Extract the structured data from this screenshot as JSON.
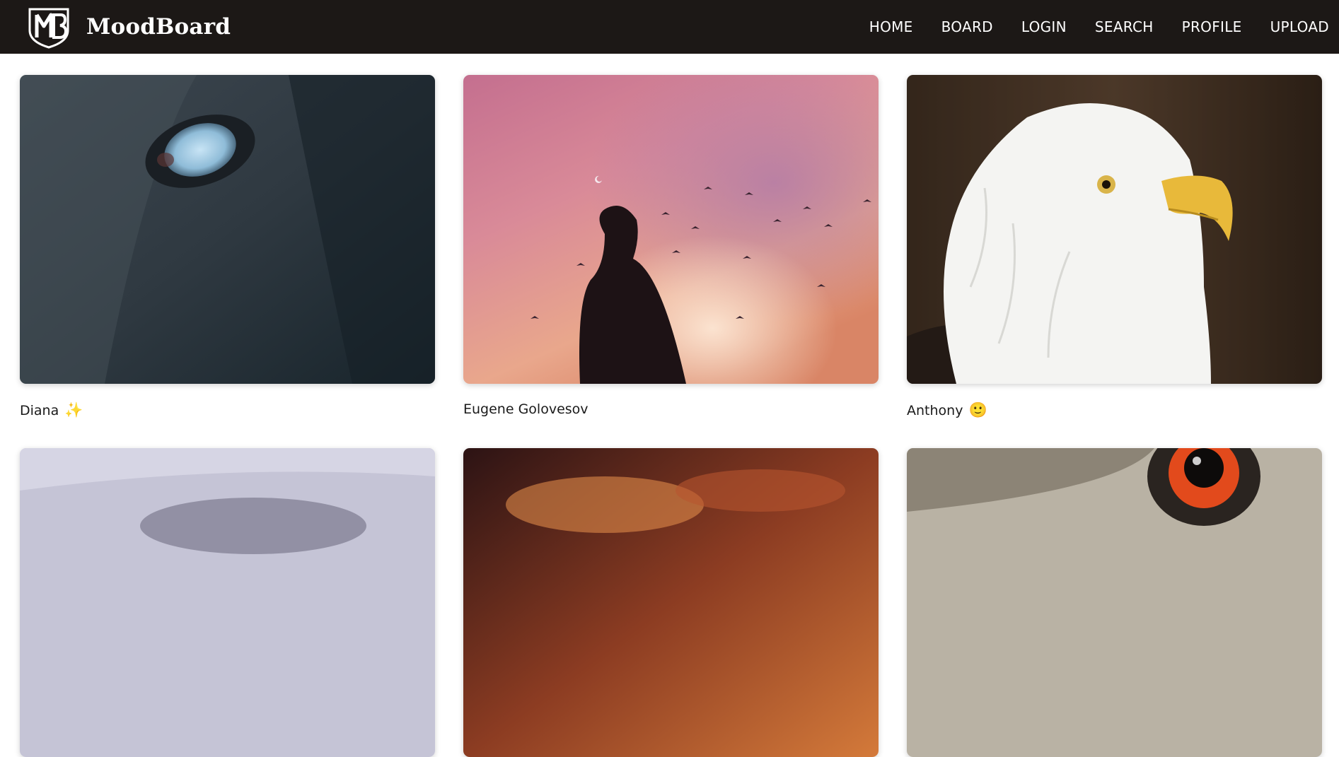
{
  "brand": {
    "name": "MoodBoard",
    "logo_icon": "mb-monogram-shield-icon"
  },
  "nav": {
    "items": [
      {
        "label": "HOME"
      },
      {
        "label": "BOARD"
      },
      {
        "label": "LOGIN"
      },
      {
        "label": "SEARCH"
      },
      {
        "label": "PROFILE"
      },
      {
        "label": "UPLOAD"
      }
    ]
  },
  "cards": [
    {
      "author": "Diana",
      "emoji": "✨",
      "image": "horse-eye-photo"
    },
    {
      "author": "Eugene Golovesov",
      "emoji": "",
      "image": "woman-pink-sky-birds-photo"
    },
    {
      "author": "Anthony",
      "emoji": "🙂",
      "image": "bald-eagle-photo"
    },
    {
      "author": "",
      "emoji": "",
      "image": "white-animal-fur-photo"
    },
    {
      "author": "",
      "emoji": "",
      "image": "fiery-clouds-photo"
    },
    {
      "author": "",
      "emoji": "",
      "image": "owl-eye-photo"
    }
  ],
  "colors": {
    "header_bg": "#1c1816",
    "header_text": "#ffffff",
    "page_bg": "#ffffff"
  }
}
